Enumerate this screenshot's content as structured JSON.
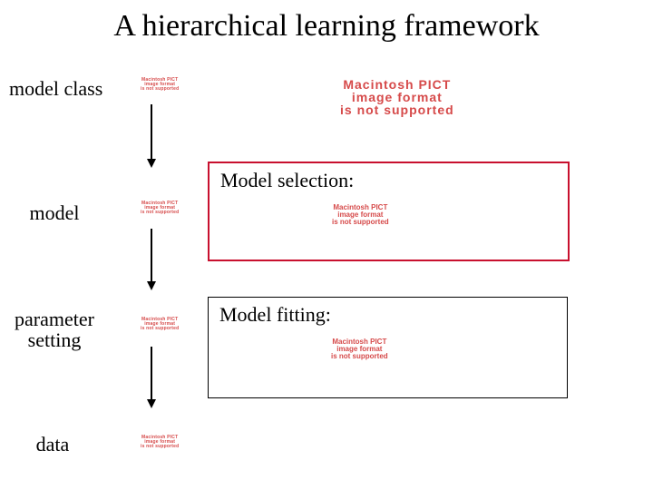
{
  "title": "A hierarchical learning framework",
  "levels": {
    "model_class": "model class",
    "model": "model",
    "parameter_setting": "parameter\nsetting",
    "data": "data"
  },
  "boxes": {
    "selection": "Model selection:",
    "fitting": "Model fitting:"
  },
  "pict_error": "Macintosh PICT\nimage format\nis not supported"
}
